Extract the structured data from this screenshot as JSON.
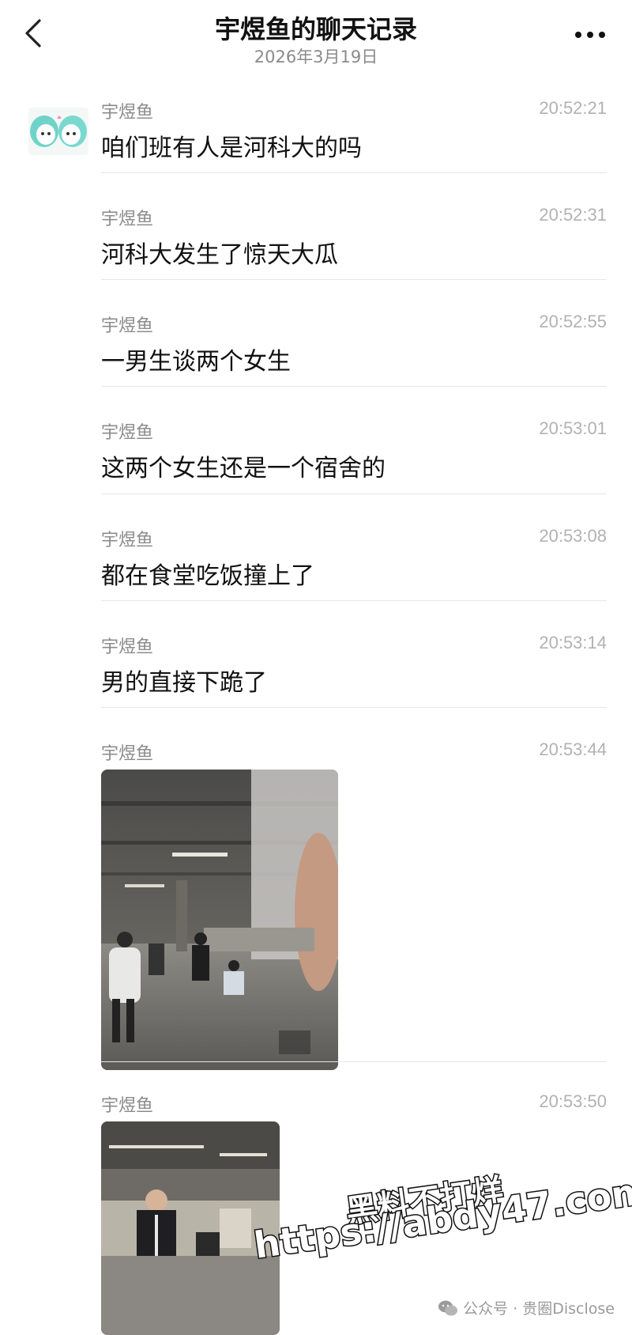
{
  "header": {
    "title": "宇煜鱼的聊天记录",
    "date": "2026年3月19日",
    "back_icon": "chevron-left-icon",
    "more_icon": "more-dots-icon"
  },
  "messages": [
    {
      "sender": "宇煜鱼",
      "time": "20:52:21",
      "text": "咱们班有人是河科大的吗"
    },
    {
      "sender": "宇煜鱼",
      "time": "20:52:31",
      "text": "河科大发生了惊天大瓜"
    },
    {
      "sender": "宇煜鱼",
      "time": "20:52:55",
      "text": "一男生谈两个女生"
    },
    {
      "sender": "宇煜鱼",
      "time": "20:53:01",
      "text": "这两个女生还是一个宿舍的"
    },
    {
      "sender": "宇煜鱼",
      "time": "20:53:08",
      "text": "都在食堂吃饭撞上了"
    },
    {
      "sender": "宇煜鱼",
      "time": "20:53:14",
      "text": "男的直接下跪了"
    },
    {
      "sender": "宇煜鱼",
      "time": "20:53:44",
      "type": "image"
    },
    {
      "sender": "宇煜鱼",
      "time": "20:53:50",
      "type": "image"
    }
  ],
  "watermark": {
    "line1": "黑料不打烊",
    "line2": "https://abdy47.com",
    "source": "公众号 · 贵圈Disclose"
  }
}
